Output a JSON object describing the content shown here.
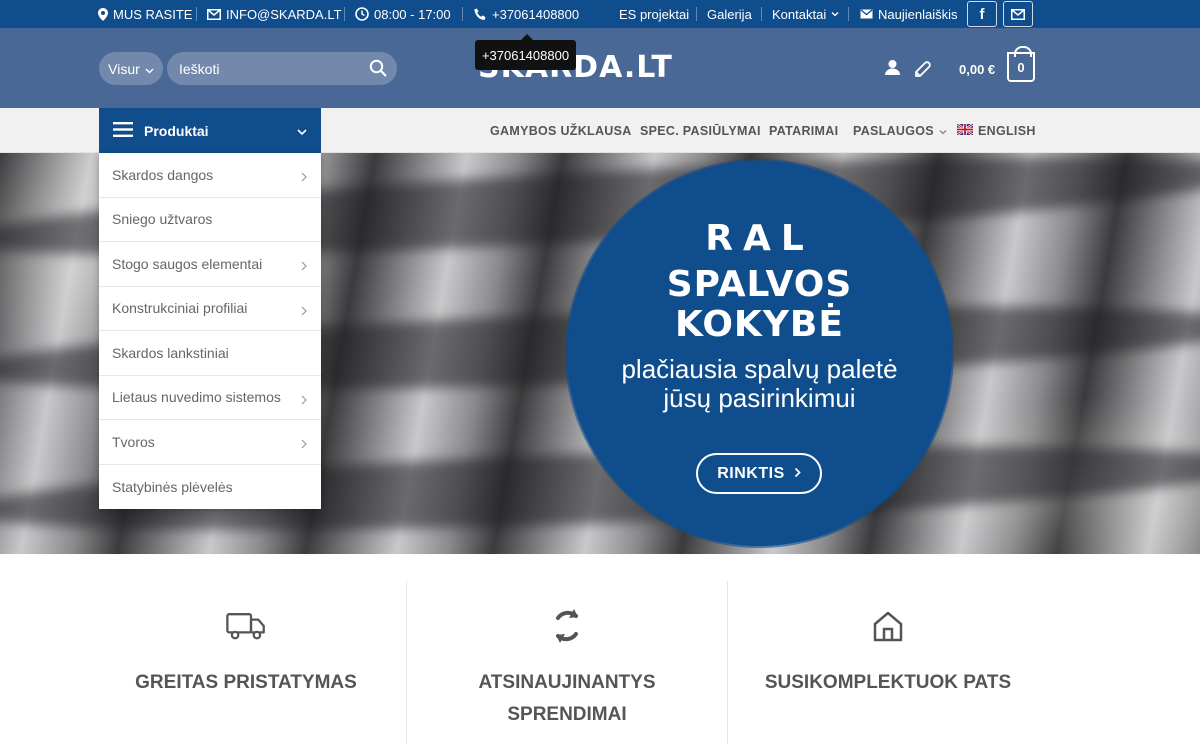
{
  "topbar": {
    "location_label": "MUS RASITE",
    "email_label": "INFO@SKARDA.LT",
    "hours_label": "08:00 - 17:00",
    "phone_label": "+37061408800",
    "links": [
      "ES projektai",
      "Galerija",
      "Kontaktai",
      "Naujienlaiškis"
    ],
    "social": {
      "facebook_glyph": "f"
    }
  },
  "header": {
    "scope_label": "Visur",
    "search_placeholder": "Ieškoti",
    "logo_text": "SKARDA.LT",
    "tooltip_text": "+37061408800",
    "cart_total": "0,00 €",
    "cart_count": "0"
  },
  "nav": {
    "products_label": "Produktai",
    "links": [
      "GAMYBOS UŽKLAUSA",
      "SPEC. PASIŪLYMAI",
      "PATARIMAI",
      "PASLAUGOS",
      "ENGLISH"
    ]
  },
  "dropdown": {
    "items": [
      "Skardos dangos",
      "Sniego užtvaros",
      "Stogo saugos elementai",
      "Konstrukciniai profiliai",
      "Skardos lankstiniai",
      "Lietaus nuvedimo sistemos",
      "Tvoros",
      "Statybinės plėvelės"
    ]
  },
  "hero": {
    "line1": "RAL",
    "line2a": "SPALVOS",
    "line2b": "KOKYBĖ",
    "sub1": "plačiausia spalvų paletė",
    "sub2": "jūsų pasirinkimui",
    "cta_label": "RINKTIS"
  },
  "features": {
    "items": [
      {
        "title": "GREITAS PRISTATYMAS",
        "icon": "truck-icon"
      },
      {
        "title": "ATSINAUJINANTYS SPRENDIMAI",
        "icon": "refresh-icon"
      },
      {
        "title": "SUSIKOMPLEKTUOK PATS",
        "icon": "home-icon"
      }
    ]
  },
  "colors": {
    "brand_blue": "#0f4d8c",
    "header_blue": "#496896",
    "nav_bg": "#f1f1f1"
  }
}
